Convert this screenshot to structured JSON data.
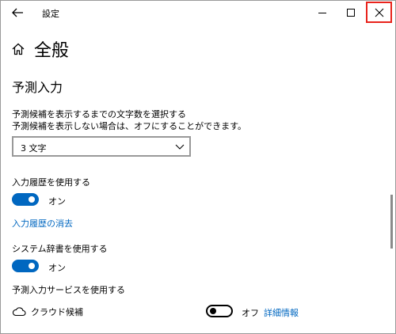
{
  "window": {
    "title": "設定",
    "accent": "#0067c0",
    "close_highlight": "#e8231c"
  },
  "header": {
    "title": "全般"
  },
  "section": {
    "title": "予測入力",
    "desc_line1": "予測候補を表示するまでの文字数を選択する",
    "desc_line2": "予測候補を表示しない場合は、オフにすることができます。",
    "select_value": "3 文字"
  },
  "history": {
    "label": "入力履歴を使用する",
    "toggle_state": "オン",
    "clear_link": "入力履歴の消去"
  },
  "dictionary": {
    "label": "システム辞書を使用する",
    "toggle_state": "オン"
  },
  "service": {
    "label": "予測入力サービスを使用する",
    "cloud_label": "クラウド候補",
    "toggle_state": "オフ",
    "detail_link": "詳細情報"
  },
  "icons": {
    "back": "back-arrow-icon",
    "minimize": "minimize-icon",
    "maximize": "maximize-icon",
    "close": "close-icon",
    "home": "home-icon",
    "chevron": "chevron-down-icon",
    "cloud": "cloud-icon"
  }
}
